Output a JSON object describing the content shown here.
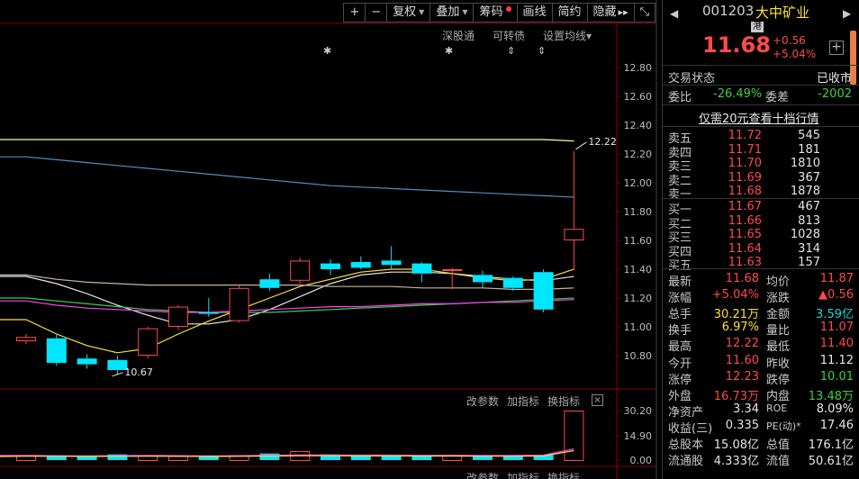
{
  "toolbar": {
    "plus": "+",
    "minus": "−",
    "fuquan": "复权",
    "diejia": "叠加",
    "chouma": "筹码",
    "huaxian": "画线",
    "jianyue": "简约",
    "yincang": "隐藏",
    "hide_arrows": "▸▸",
    "restore": "⤡"
  },
  "chart_menu": {
    "shengutong": "深股通",
    "kezhuanzhai": "可转债",
    "shezhi_junxian": "设置均线",
    "shezhi_arrow": "▾",
    "star": "✱",
    "updown": "⇕",
    "indicator_1": {
      "gaicanshu": "改参数",
      "jiazhibiao": "加指标",
      "huanzhibiao": "换指标",
      "close": "×"
    },
    "indicator_2": {
      "gaicanshu": "改参数",
      "jiazhibiao": "加指标",
      "huanzhibiao": "换指标"
    }
  },
  "chart_data": {
    "type": "candlestick",
    "y_ticks": [
      "12.80",
      "12.60",
      "12.40",
      "12.20",
      "12.00",
      "11.80",
      "11.60",
      "11.40",
      "11.20",
      "11.00",
      "10.80"
    ],
    "ylim": [
      10.6,
      12.9
    ],
    "annotations": {
      "high_label": "12.22",
      "low_label": "10.67"
    },
    "candles": [
      {
        "open": 10.9,
        "close": 10.93,
        "high": 10.95,
        "low": 10.88
      },
      {
        "open": 10.92,
        "close": 10.75,
        "high": 10.95,
        "low": 10.73
      },
      {
        "open": 10.78,
        "close": 10.74,
        "high": 10.81,
        "low": 10.71
      },
      {
        "open": 10.77,
        "close": 10.7,
        "high": 10.8,
        "low": 10.67
      },
      {
        "open": 10.8,
        "close": 10.99,
        "high": 11.0,
        "low": 10.78
      },
      {
        "open": 11.0,
        "close": 11.14,
        "high": 11.15,
        "low": 10.98
      },
      {
        "open": 11.1,
        "close": 11.09,
        "high": 11.2,
        "low": 11.07
      },
      {
        "open": 11.04,
        "close": 11.27,
        "high": 11.29,
        "low": 11.03
      },
      {
        "open": 11.33,
        "close": 11.27,
        "high": 11.37,
        "low": 11.25
      },
      {
        "open": 11.32,
        "close": 11.46,
        "high": 11.48,
        "low": 11.3
      },
      {
        "open": 11.44,
        "close": 11.4,
        "high": 11.47,
        "low": 11.36
      },
      {
        "open": 11.45,
        "close": 11.41,
        "high": 11.49,
        "low": 11.4
      },
      {
        "open": 11.46,
        "close": 11.43,
        "high": 11.56,
        "low": 11.4
      },
      {
        "open": 11.44,
        "close": 11.37,
        "high": 11.45,
        "low": 11.31
      },
      {
        "open": 11.4,
        "close": 11.4,
        "high": 11.41,
        "low": 11.26
      },
      {
        "open": 11.36,
        "close": 11.31,
        "high": 11.39,
        "low": 11.27
      },
      {
        "open": 11.34,
        "close": 11.27,
        "high": 11.35,
        "low": 11.25
      },
      {
        "open": 11.38,
        "close": 11.12,
        "high": 11.4,
        "low": 11.1
      },
      {
        "open": 11.6,
        "close": 11.68,
        "high": 12.22,
        "low": 11.4
      }
    ],
    "ma_lines": [
      {
        "name": "MA-yellow-long",
        "color": "#ffffa0",
        "values": [
          12.3,
          12.3,
          12.3,
          12.3,
          12.3,
          12.3,
          12.3,
          12.3,
          12.3,
          12.3,
          12.3,
          12.3,
          12.3,
          12.3,
          12.3,
          12.3,
          12.3,
          12.3,
          12.29
        ]
      },
      {
        "name": "MA-blue",
        "color": "#4f8fc0",
        "values": [
          12.18,
          12.16,
          12.14,
          12.12,
          12.1,
          12.08,
          12.06,
          12.04,
          12.02,
          12.0,
          11.98,
          11.97,
          11.96,
          11.95,
          11.94,
          11.93,
          11.92,
          11.91,
          11.9
        ]
      },
      {
        "name": "MA-white",
        "color": "#e6e6e6",
        "values": [
          11.35,
          11.3,
          11.23,
          11.15,
          11.08,
          11.02,
          11.02,
          11.05,
          11.12,
          11.21,
          11.3,
          11.36,
          11.38,
          11.38,
          11.37,
          11.35,
          11.33,
          11.32,
          11.35
        ]
      },
      {
        "name": "MA-yellow",
        "color": "#ffe033",
        "values": [
          11.05,
          10.95,
          10.87,
          10.82,
          10.85,
          10.95,
          11.04,
          11.12,
          11.2,
          11.28,
          11.33,
          11.38,
          11.4,
          11.4,
          11.37,
          11.34,
          11.32,
          11.33,
          11.4
        ]
      },
      {
        "name": "MA-beige",
        "color": "#c8b7a0",
        "values": [
          11.36,
          11.33,
          11.31,
          11.3,
          11.29,
          11.29,
          11.29,
          11.29,
          11.29,
          11.29,
          11.28,
          11.28,
          11.28,
          11.27,
          11.27,
          11.27,
          11.26,
          11.26,
          11.27
        ]
      },
      {
        "name": "MA-green",
        "color": "#3cd23c",
        "values": [
          11.2,
          11.18,
          11.16,
          11.14,
          11.12,
          11.11,
          11.1,
          11.1,
          11.1,
          11.11,
          11.12,
          11.13,
          11.14,
          11.15,
          11.16,
          11.17,
          11.18,
          11.19,
          11.2
        ]
      },
      {
        "name": "MA-magenta",
        "color": "#ff40ff",
        "values": [
          11.18,
          11.15,
          11.13,
          11.12,
          11.11,
          11.1,
          11.1,
          11.11,
          11.12,
          11.13,
          11.14,
          11.14,
          11.15,
          11.16,
          11.16,
          11.17,
          11.17,
          11.18,
          11.19
        ]
      }
    ],
    "volume": {
      "y_ticks": [
        "30.20",
        "14.90",
        "0.00"
      ],
      "ylim": [
        0,
        30.2
      ],
      "values": [
        3.0,
        2.5,
        2.0,
        3.5,
        3.0,
        2.5,
        2.0,
        3.0,
        4.0,
        5.5,
        3.5,
        2.8,
        2.8,
        2.6,
        2.8,
        2.4,
        2.8,
        3.2,
        30.2
      ],
      "ma_values": [
        2.8,
        2.7,
        2.6,
        2.7,
        2.8,
        2.7,
        2.6,
        2.7,
        2.9,
        3.1,
        3.1,
        3.0,
        3.0,
        2.9,
        2.9,
        2.8,
        2.8,
        3.0,
        6.8
      ]
    }
  },
  "quote": {
    "code": "001203",
    "name": "大中矿业",
    "hk_badge": "港",
    "price": "11.68",
    "change": "+0.56",
    "change_pct": "+5.04%",
    "add": "+",
    "nav_left": "◀",
    "nav_right": "▶",
    "status_label": "交易状态",
    "status_value": "已收市",
    "weibi_label": "委比",
    "weibi_value": "-26.49%",
    "weicha_label": "委差",
    "weicha_value": "-2002",
    "notice": "仅需20元查看十档行情"
  },
  "order_book": {
    "asks": [
      {
        "label": "卖五",
        "price": "11.72",
        "volume": "545"
      },
      {
        "label": "卖四",
        "price": "11.71",
        "volume": "181"
      },
      {
        "label": "卖三",
        "price": "11.70",
        "volume": "1810"
      },
      {
        "label": "卖二",
        "price": "11.69",
        "volume": "367"
      },
      {
        "label": "卖一",
        "price": "11.68",
        "volume": "1878"
      }
    ],
    "bids": [
      {
        "label": "买一",
        "price": "11.67",
        "volume": "467"
      },
      {
        "label": "买二",
        "price": "11.66",
        "volume": "813"
      },
      {
        "label": "买三",
        "price": "11.65",
        "volume": "1028"
      },
      {
        "label": "买四",
        "price": "11.64",
        "volume": "314"
      },
      {
        "label": "买五",
        "price": "11.63",
        "volume": "157"
      }
    ]
  },
  "stats": [
    [
      {
        "k": "最新",
        "v": "11.68",
        "c": "red"
      },
      {
        "k": "均价",
        "v": "11.87",
        "c": "red"
      }
    ],
    [
      {
        "k": "涨幅",
        "v": "+5.04%",
        "c": "red"
      },
      {
        "k": "涨跌",
        "v": "▲0.56",
        "c": "red"
      }
    ],
    [
      {
        "k": "总手",
        "v": "30.21万",
        "c": "yellow"
      },
      {
        "k": "金额",
        "v": "3.59亿",
        "c": "cyan"
      }
    ],
    [
      {
        "k": "换手",
        "v": "6.97%",
        "c": "yellow"
      },
      {
        "k": "量比",
        "v": "11.07",
        "c": "red"
      }
    ],
    [
      {
        "k": "最高",
        "v": "12.22",
        "c": "red"
      },
      {
        "k": "最低",
        "v": "11.40",
        "c": "red"
      }
    ],
    [
      {
        "k": "今开",
        "v": "11.60",
        "c": "red"
      },
      {
        "k": "昨收",
        "v": "11.12",
        "c": "white"
      }
    ],
    [
      {
        "k": "涨停",
        "v": "12.23",
        "c": "red"
      },
      {
        "k": "跌停",
        "v": "10.01",
        "c": "green"
      }
    ],
    [
      {
        "k": "外盘",
        "v": "16.73万",
        "c": "red"
      },
      {
        "k": "内盘",
        "v": "13.48万",
        "c": "green"
      }
    ],
    [
      {
        "k": "净资产",
        "v": "3.34",
        "c": "white"
      },
      {
        "k": "ROE",
        "v": "8.09%",
        "c": "white"
      }
    ],
    [
      {
        "k": "收益(三)",
        "v": "0.335",
        "c": "white"
      },
      {
        "k": "PE(动)*",
        "v": "17.46",
        "c": "white"
      }
    ],
    [
      {
        "k": "总股本",
        "v": "15.08亿",
        "c": "white"
      },
      {
        "k": "总值",
        "v": "176.1亿",
        "c": "white"
      }
    ],
    [
      {
        "k": "流通股",
        "v": "4.333亿",
        "c": "white"
      },
      {
        "k": "流值",
        "v": "50.61亿",
        "c": "white"
      }
    ]
  ],
  "colors": {
    "up": "#ff4a4a",
    "down": "#00e6ff",
    "grid": "#3a0000",
    "axis": "#8a0000"
  }
}
